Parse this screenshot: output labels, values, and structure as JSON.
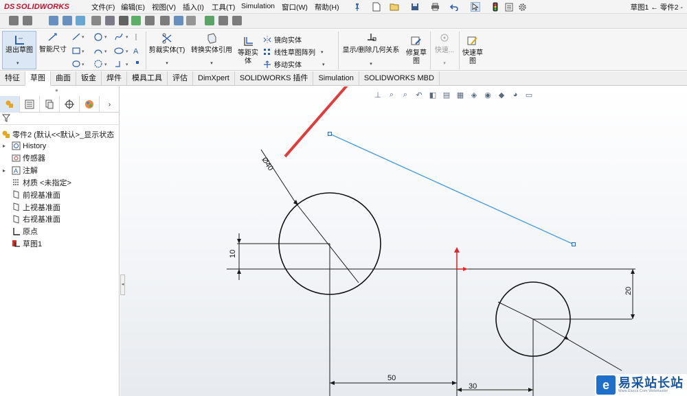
{
  "app": {
    "brand_ds": "DS",
    "brand_name": "SOLIDWORKS"
  },
  "menu": [
    "文件(F)",
    "编辑(E)",
    "视图(V)",
    "插入(I)",
    "工具(T)",
    "Simulation",
    "窗口(W)",
    "帮助(H)"
  ],
  "window_title": "草图1 ← 零件2 -",
  "commands": {
    "exit_sketch": "退出草图",
    "smart_dimension": "智能尺寸",
    "trim": "剪裁实体(T)",
    "convert": "转换实体引用",
    "offset": "等距实体",
    "mirror": "镜向实体",
    "linear_pattern": "线性草图阵列",
    "move": "移动实体",
    "show_delete_relations": "显示/删除几何关系",
    "repair_sketch": "修复草图",
    "quick_snaps": "快速...",
    "rapid_sketch": "快速草图"
  },
  "tabs": [
    {
      "label": "特征",
      "active": false
    },
    {
      "label": "草图",
      "active": true
    },
    {
      "label": "曲面",
      "active": false
    },
    {
      "label": "钣金",
      "active": false
    },
    {
      "label": "焊件",
      "active": false
    },
    {
      "label": "模具工具",
      "active": false
    },
    {
      "label": "评估",
      "active": false
    },
    {
      "label": "DimXpert",
      "active": false
    },
    {
      "label": "SOLIDWORKS 插件",
      "active": false
    },
    {
      "label": "Simulation",
      "active": false
    },
    {
      "label": "SOLIDWORKS MBD",
      "active": false
    }
  ],
  "tree": {
    "root": "零件2 (默认<<默认>_显示状态",
    "items": [
      {
        "label": "History",
        "icon": "history-icon",
        "expandable": true
      },
      {
        "label": "传感器",
        "icon": "sensor-icon",
        "expandable": false
      },
      {
        "label": "注解",
        "icon": "annotation-icon",
        "expandable": true
      },
      {
        "label": "材质 <未指定>",
        "icon": "material-icon",
        "expandable": false
      },
      {
        "label": "前视基准面",
        "icon": "plane-icon",
        "expandable": false
      },
      {
        "label": "上视基准面",
        "icon": "plane-icon",
        "expandable": false
      },
      {
        "label": "右视基准面",
        "icon": "plane-icon",
        "expandable": false
      },
      {
        "label": "原点",
        "icon": "origin-icon",
        "expandable": false
      },
      {
        "label": "草图1",
        "icon": "sketch-icon",
        "expandable": false
      }
    ]
  },
  "sketch": {
    "dimensions": {
      "diameter": "Ø40",
      "vertical_offset": "10",
      "horizontal_50": "50",
      "vertical_20": "20",
      "horizontal_30": "30"
    }
  },
  "watermark": {
    "title": "易采站长站",
    "subtitle": "Www.Easck.Com Webmaster"
  },
  "colors": {
    "accent": "#c8102e",
    "selection_line": "#4a9fe0",
    "arrow": "#e23b3b",
    "active_tab_bg": "#ffffff"
  }
}
